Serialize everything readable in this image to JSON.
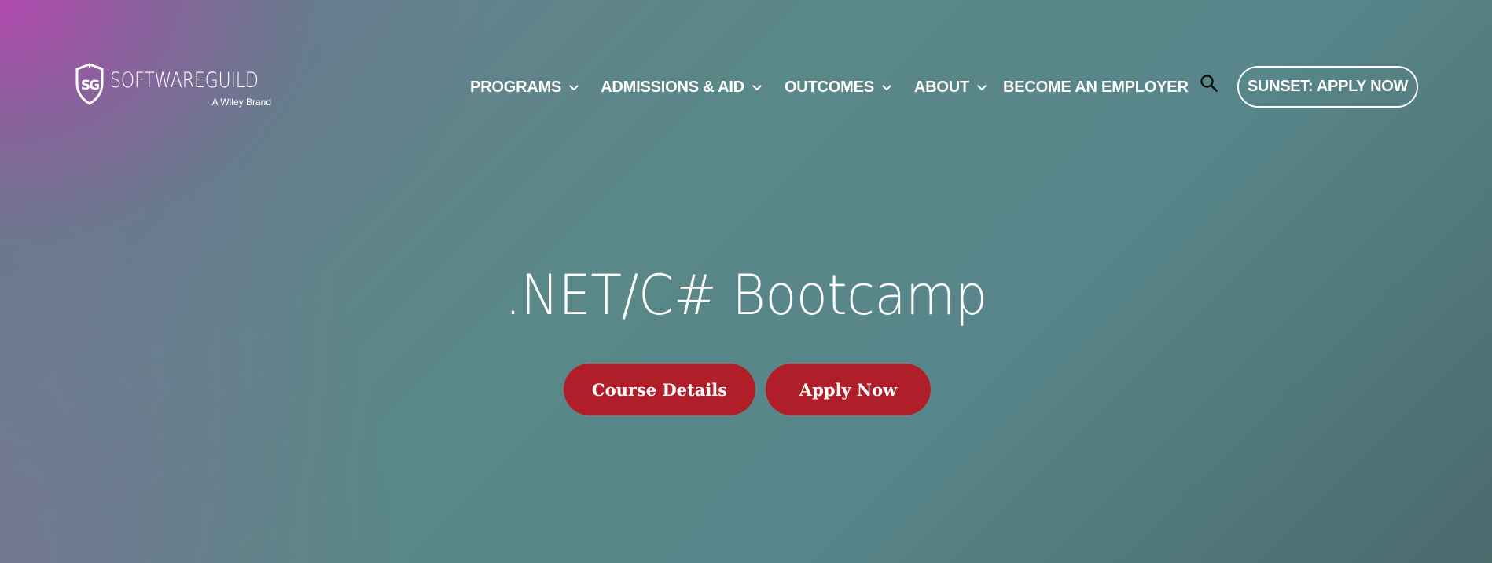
{
  "brand": {
    "logo_wordmark": "SOFTWAREGUILD",
    "logo_tagline": "A Wiley Brand",
    "logo_monogram": "SG",
    "icon": "shield-logo-icon"
  },
  "nav": {
    "items": [
      {
        "label": "PROGRAMS",
        "has_dropdown": true
      },
      {
        "label": "ADMISSIONS & AID",
        "has_dropdown": true
      },
      {
        "label": "OUTCOMES",
        "has_dropdown": true
      },
      {
        "label": "ABOUT",
        "has_dropdown": true
      },
      {
        "label": "BECOME AN EMPLOYER",
        "has_dropdown": false
      }
    ],
    "search_icon": "search-icon",
    "cta_label": "SUNSET: APPLY NOW"
  },
  "hero": {
    "title": ".NET/C# Bootcamp",
    "primary_button": "Course Details",
    "secondary_button": "Apply Now"
  },
  "colors": {
    "button_red": "#b01f29",
    "text": "#ffffff",
    "gradient_magenta": "#b44aaf",
    "gradient_teal": "#58868a"
  }
}
